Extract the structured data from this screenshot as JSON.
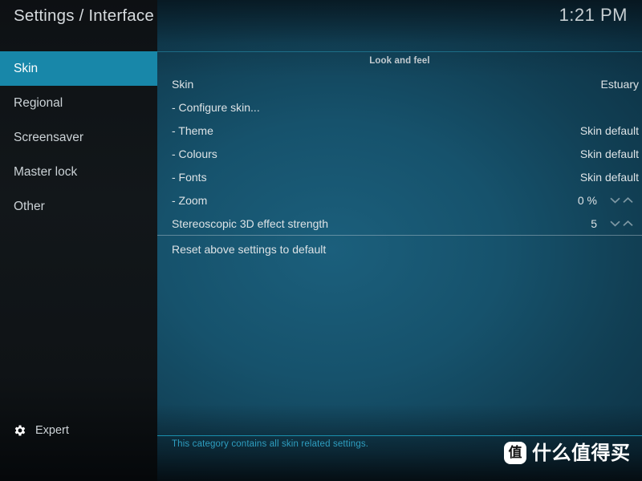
{
  "header": {
    "title": "Settings / Interface",
    "clock": "1:21 PM"
  },
  "sidebar": {
    "items": [
      {
        "label": "Skin",
        "selected": true
      },
      {
        "label": "Regional",
        "selected": false
      },
      {
        "label": "Screensaver",
        "selected": false
      },
      {
        "label": "Master lock",
        "selected": false
      },
      {
        "label": "Other",
        "selected": false
      }
    ],
    "level_button": {
      "label": "Expert",
      "icon": "gear-icon"
    }
  },
  "main": {
    "section_title": "Look and feel",
    "settings": [
      {
        "label": "Skin",
        "value": "Estuary",
        "spinner": false
      },
      {
        "label": "- Configure skin...",
        "value": "",
        "spinner": false
      },
      {
        "label": "- Theme",
        "value": "Skin default",
        "spinner": false
      },
      {
        "label": "- Colours",
        "value": "Skin default",
        "spinner": false
      },
      {
        "label": "- Fonts",
        "value": "Skin default",
        "spinner": false
      },
      {
        "label": "- Zoom",
        "value": "0 %",
        "spinner": true
      },
      {
        "label": "Stereoscopic 3D effect strength",
        "value": "5",
        "spinner": true
      }
    ],
    "reset": {
      "label": "Reset above settings to default",
      "value": ""
    }
  },
  "footer": {
    "hint": "This category contains all skin related settings."
  },
  "watermark": {
    "badge": "值",
    "text": "什么值得买"
  },
  "colors": {
    "accent": "#1887a9",
    "hint": "#2e9ec0",
    "text": "#dde3e6",
    "spinner": "#7d97a3"
  }
}
